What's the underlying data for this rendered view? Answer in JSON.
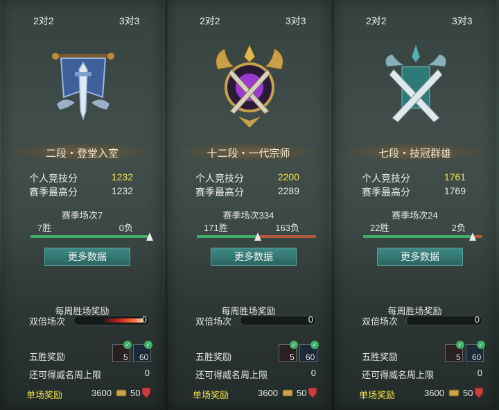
{
  "tabs": {
    "t1": "2对2",
    "t2": "3对3"
  },
  "labels": {
    "personal_score": "个人竞技分",
    "season_high": "赛季最高分",
    "more_data": "更多数据",
    "weekly_reward": "每周胜场奖励",
    "double_count": "双倍场次",
    "five_win_reward": "五胜奖励",
    "renown_limit": "还可得威名周上限",
    "single_reward": "单场奖励"
  },
  "panels": [
    {
      "rank_title": "二段・登堂入室",
      "personal_score": "1232",
      "season_high": "1232",
      "season_games": "赛季场次7",
      "wins": "7胜",
      "losses": "0负",
      "win_ratio": 1.0,
      "double_value": "0",
      "five_win_items": [
        "5",
        "60"
      ],
      "renown_limit": "0",
      "single_coin": "3600",
      "single_honor": "50",
      "emblem_icon": "banner-sword-emblem-icon"
    },
    {
      "rank_title": "十二段・一代宗师",
      "personal_score": "2200",
      "season_high": "2289",
      "season_games": "赛季场次334",
      "wins": "171胜",
      "losses": "163负",
      "win_ratio": 0.512,
      "double_value": "0",
      "five_win_items": [
        "5",
        "60"
      ],
      "renown_limit": "0",
      "single_coin": "3600",
      "single_honor": "50",
      "emblem_icon": "golden-crossed-swords-emblem-icon"
    },
    {
      "rank_title": "七段・技冠群雄",
      "personal_score": "1761",
      "season_high": "1769",
      "season_games": "赛季场次24",
      "wins": "22胜",
      "losses": "2负",
      "win_ratio": 0.917,
      "double_value": "0",
      "five_win_items": [
        "5",
        "60"
      ],
      "renown_limit": "0",
      "single_coin": "3600",
      "single_honor": "50",
      "emblem_icon": "teal-crossed-swords-emblem-icon"
    }
  ],
  "colors": {
    "accent_yellow": "#f2e24a",
    "win_green": "#3fae69",
    "loss_red": "#b45a3c",
    "button_teal": "#2a6460"
  }
}
